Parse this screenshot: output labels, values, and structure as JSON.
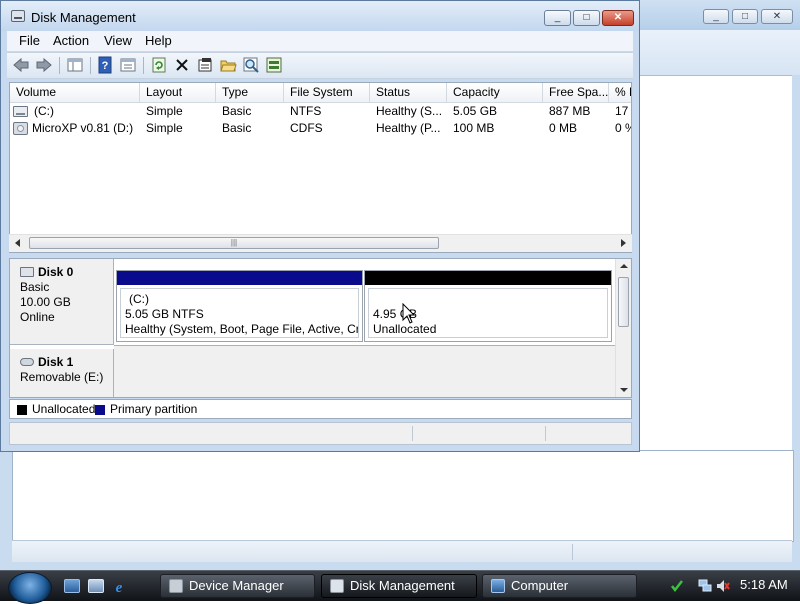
{
  "window": {
    "title": "Disk Management",
    "minimize": "_",
    "maximize": "□",
    "close": "✕"
  },
  "menu": [
    "File",
    "Action",
    "View",
    "Help"
  ],
  "toolbar_icons": [
    "back-icon",
    "forward-icon",
    "console-tree-icon",
    "help-icon",
    "properties-icon",
    "refresh-icon",
    "delete-icon",
    "properties-page-icon",
    "open-icon",
    "search-icon",
    "disk-settings-icon"
  ],
  "volume_list": {
    "columns": [
      "Volume",
      "Layout",
      "Type",
      "File System",
      "Status",
      "Capacity",
      "Free Spa...",
      "% F"
    ],
    "rows": [
      {
        "volume": "(C:)",
        "layout": "Simple",
        "type": "Basic",
        "fs": "NTFS",
        "status": "Healthy (S...",
        "capacity": "5.05 GB",
        "free": "887 MB",
        "pct": "17"
      },
      {
        "volume": "MicroXP v0.81 (D:)",
        "layout": "Simple",
        "type": "Basic",
        "fs": "CDFS",
        "status": "Healthy (P...",
        "capacity": "100 MB",
        "free": "0 MB",
        "pct": "0 %"
      }
    ]
  },
  "disks": [
    {
      "name": "Disk 0",
      "type": "Basic",
      "size": "10.00 GB",
      "state": "Online"
    },
    {
      "name": "Disk 1",
      "type": "Removable (E:)"
    }
  ],
  "partitions": {
    "c": {
      "label": "(C:)",
      "size": "5.05 GB NTFS",
      "status": "Healthy (System, Boot, Page File, Active, Cra"
    },
    "unalloc": {
      "size": "4.95 GB",
      "status": "Unallocated"
    }
  },
  "legend": [
    {
      "label": "Unallocated",
      "color": "#000000"
    },
    {
      "label": "Primary partition",
      "color": "#0a0a8c"
    }
  ],
  "taskbar": {
    "buttons": [
      "Device Manager",
      "Disk Management",
      "Computer"
    ],
    "clock": "5:18 AM"
  },
  "colors": {
    "primary_partition": "#0a0a8c",
    "unallocated": "#000000",
    "taskbar": "#1c2026"
  }
}
